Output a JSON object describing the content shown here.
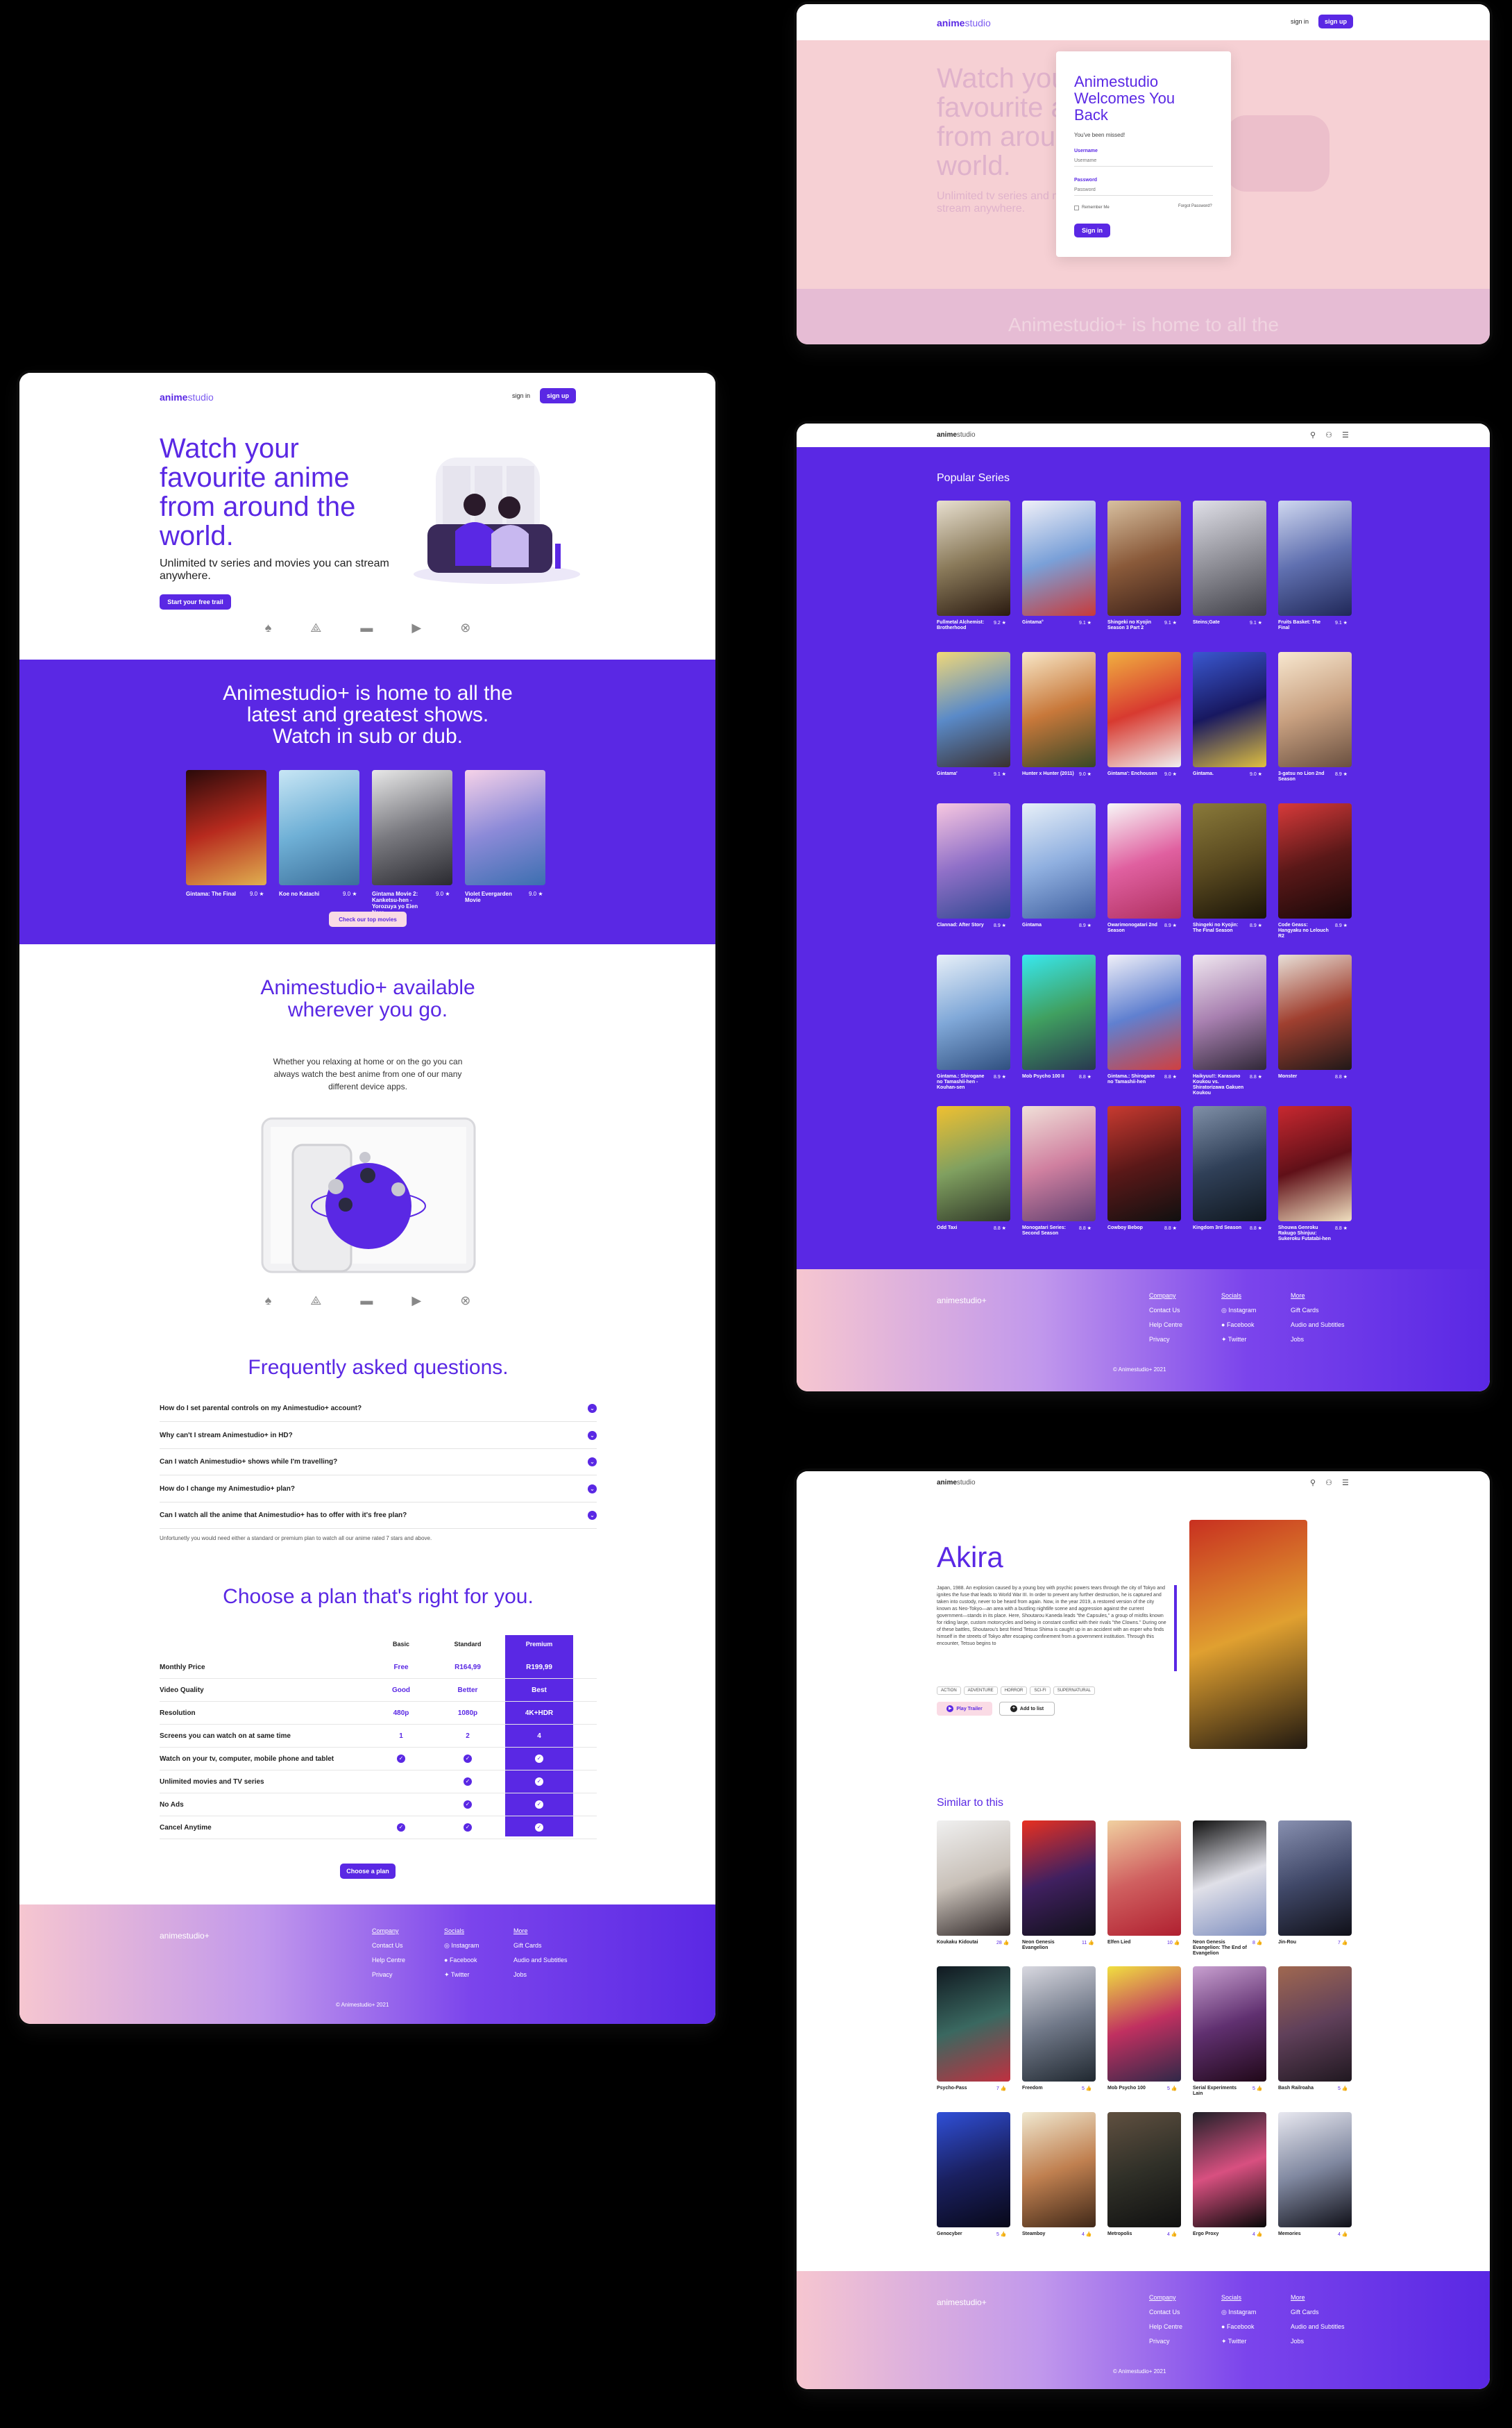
{
  "brand": {
    "logo_a": "anime",
    "logo_b": "studio",
    "logo_plus": "animestudio+"
  },
  "nav": {
    "signin": "sign in",
    "signup": "sign up"
  },
  "hero": {
    "title": "Watch your favourite anime from around the world.",
    "subtitle": "Unlimited tv series and movies you can stream anywhere.",
    "cta": "Start your free trail"
  },
  "devices": [
    "playstation-icon",
    "apple-tv-icon",
    "tv-icon",
    "google-play-icon",
    "xbox-icon"
  ],
  "latest": {
    "title": "Animestudio+ is home to all the latest and greatest shows. Watch in sub or dub.",
    "cta": "Check our top movies",
    "movies": [
      {
        "title": "Gintama: The Final",
        "rating": "9.0 ★",
        "colors": [
          "#2a0a0a",
          "#b72a1e",
          "#e0b050"
        ]
      },
      {
        "title": "Koe no Katachi",
        "rating": "9.0 ★",
        "colors": [
          "#c8e6f5",
          "#6fb0d6",
          "#3c6f9a"
        ]
      },
      {
        "title": "Gintama Movie 2: Kanketsu-hen - Yorozuya yo Eien Nare",
        "rating": "9.0 ★",
        "colors": [
          "#e8e8e8",
          "#7a7a80",
          "#2a2a30"
        ]
      },
      {
        "title": "Violet Evergarden Movie",
        "rating": "9.0 ★",
        "colors": [
          "#f6d2e8",
          "#8c8ad8",
          "#3c6fb0"
        ]
      }
    ]
  },
  "available": {
    "title": "Animestudio+ available wherever you go.",
    "text": "Whether you relaxing at home or on the go you can always watch the best anime from one of our many different device apps."
  },
  "faq": {
    "title": "Frequently asked questions.",
    "items": [
      "How do I set parental controls on my Animestudio+ account?",
      "Why can't I stream Animestudio+ in HD?",
      "Can I watch Animestudio+ shows while I'm travelling?",
      "How do I change my Animestudio+ plan?",
      "Can I watch all the anime that Animestudio+ has to offer with it's free plan?"
    ],
    "answer": "Unfortunetly you would need either a standard or premium plan to watch all our anime rated 7 stars and above."
  },
  "plans": {
    "title": "Choose a plan that's right for you.",
    "cols": [
      "Basic",
      "Standard",
      "Premium"
    ],
    "cta": "Choose a plan",
    "rows": [
      {
        "label": "Monthly Price",
        "vals": [
          "Free",
          "R164,99",
          "R199,99"
        ]
      },
      {
        "label": "Video Quality",
        "vals": [
          "Good",
          "Better",
          "Best"
        ]
      },
      {
        "label": "Resolution",
        "vals": [
          "480p",
          "1080p",
          "4K+HDR"
        ]
      },
      {
        "label": "Screens you can watch on at same time",
        "vals": [
          "1",
          "2",
          "4"
        ]
      },
      {
        "label": "Watch on your tv, computer, mobile phone and tablet",
        "vals": [
          "✓",
          "✓",
          "✓"
        ]
      },
      {
        "label": "Unlimited movies and TV series",
        "vals": [
          "",
          "✓",
          "✓"
        ]
      },
      {
        "label": "No Ads",
        "vals": [
          "",
          "✓",
          "✓"
        ]
      },
      {
        "label": "Cancel Anytime",
        "vals": [
          "✓",
          "✓",
          "✓"
        ]
      }
    ]
  },
  "footer": {
    "company": "Company",
    "company_links": [
      "Contact Us",
      "Help Centre",
      "Privacy"
    ],
    "socials": "Socials",
    "social_links": [
      "Instagram",
      "Facebook",
      "Twitter"
    ],
    "more": "More",
    "more_links": [
      "Gift Cards",
      "Audio and Subtitles",
      "Jobs"
    ],
    "copyright": "© Animestudio+ 2021"
  },
  "login": {
    "title": "Animestudio Welcomes You Back",
    "subtitle": "You've been missed!",
    "username_label": "Username",
    "username_ph": "Username",
    "password_label": "Password",
    "password_ph": "Password",
    "remember": "Remember Me",
    "forgot": "Forgot Password?",
    "signin": "Sign in",
    "bg_title": "Watch your favourite anime from around the world.",
    "bg_sub": "Unlimited tv series and movies you can stream anywhere.",
    "bg_band": "Animestudio+ is home to all the"
  },
  "popular": {
    "title": "Popular Series",
    "items": [
      {
        "t": "Fullmetal Alchemist: Brotherhood",
        "r": "9.2 ★",
        "c": [
          "#e8e0d0",
          "#8a7a5a",
          "#2a1a10"
        ]
      },
      {
        "t": "Gintama°",
        "r": "9.1 ★",
        "c": [
          "#f0f0f8",
          "#7aa0d8",
          "#c83a3a"
        ]
      },
      {
        "t": "Shingeki no Kyojin Season 3 Part 2",
        "r": "9.1 ★",
        "c": [
          "#d8c0a0",
          "#8a5a3a",
          "#3a2018"
        ]
      },
      {
        "t": "Steins;Gate",
        "r": "9.1 ★",
        "c": [
          "#e0e0e8",
          "#909098",
          "#404048"
        ]
      },
      {
        "t": "Fruits Basket: The Final",
        "r": "9.1 ★",
        "c": [
          "#d0d8f0",
          "#6070b0",
          "#202858"
        ]
      },
      {
        "t": "Gintama'",
        "r": "9.1 ★",
        "c": [
          "#f0d878",
          "#5a8ac8",
          "#3a3030"
        ]
      },
      {
        "t": "Hunter x Hunter (2011)",
        "r": "9.0 ★",
        "c": [
          "#f8e8c8",
          "#c8783a",
          "#384828"
        ]
      },
      {
        "t": "Gintama': Enchousen",
        "r": "9.0 ★",
        "c": [
          "#f0b040",
          "#d83a30",
          "#f0f0f0"
        ]
      },
      {
        "t": "Gintama.",
        "r": "9.0 ★",
        "c": [
          "#3a58d0",
          "#181860",
          "#e0c040"
        ]
      },
      {
        "t": "3-gatsu no Lion 2nd Season",
        "r": "8.9 ★",
        "c": [
          "#f8e8d0",
          "#c8a080",
          "#6a5040"
        ]
      },
      {
        "t": "Clannad: After Story",
        "r": "8.9 ★",
        "c": [
          "#f8c8e0",
          "#9070c8",
          "#304890"
        ]
      },
      {
        "t": "Gintama",
        "r": "8.9 ★",
        "c": [
          "#e8f0f8",
          "#90b0e0",
          "#4060a0"
        ]
      },
      {
        "t": "Owarimonogatari 2nd Season",
        "r": "8.9 ★",
        "c": [
          "#f8f8f8",
          "#e060a0",
          "#b03060"
        ]
      },
      {
        "t": "Shingeki no Kyojin: The Final Season",
        "r": "8.9 ★",
        "c": [
          "#8a7a3a",
          "#5a4a20",
          "#1a1408"
        ]
      },
      {
        "t": "Code Geass: Hangyaku no Lelouch R2",
        "r": "8.9 ★",
        "c": [
          "#d83a3a",
          "#5a1818",
          "#180808"
        ]
      },
      {
        "t": "Gintama.: Shirogane no Tamashii-hen - Kouhan-sen",
        "r": "8.9 ★",
        "c": [
          "#e8f0f8",
          "#80a8d8",
          "#305080"
        ]
      },
      {
        "t": "Mob Psycho 100 II",
        "r": "8.8 ★",
        "c": [
          "#38e8f0",
          "#40a060",
          "#283850"
        ]
      },
      {
        "t": "Gintama.: Shirogane no Tamashii-hen",
        "r": "8.8 ★",
        "c": [
          "#f0f0f8",
          "#6080d0",
          "#d04040"
        ]
      },
      {
        "t": "Haikyuu!!: Karasuno Koukou vs. Shiratorizawa Gakuen Koukou",
        "r": "8.8 ★",
        "c": [
          "#f0e8f0",
          "#a880b0",
          "#302838"
        ]
      },
      {
        "t": "Monster",
        "r": "8.8 ★",
        "c": [
          "#e8e0d8",
          "#a04030",
          "#201818"
        ]
      },
      {
        "t": "Odd Taxi",
        "r": "8.8 ★",
        "c": [
          "#f0c030",
          "#80a060",
          "#303828"
        ]
      },
      {
        "t": "Monogatari Series: Second Season",
        "r": "8.8 ★",
        "c": [
          "#f0e0d8",
          "#d080a0",
          "#604070"
        ]
      },
      {
        "t": "Cowboy Bebop",
        "r": "8.8 ★",
        "c": [
          "#c83a30",
          "#5a1818",
          "#101010"
        ]
      },
      {
        "t": "Kingdom 3rd Season",
        "r": "8.8 ★",
        "c": [
          "#8090a8",
          "#304058",
          "#101820"
        ]
      },
      {
        "t": "Shouwa Genroku Rakugo Shinjuu: Sukeroku Futatabi-hen",
        "r": "8.8 ★",
        "c": [
          "#c82830",
          "#601018",
          "#f0e0c0"
        ]
      }
    ]
  },
  "detail": {
    "title": "Akira",
    "desc": "Japan, 1988. An explosion caused by a young boy with psychic powers tears through the city of Tokyo and ignites the fuse that leads to World War III. In order to prevent any further destruction, he is captured and taken into custody, never to be heard from again. Now, in the year 2019, a restored version of the city known as Neo-Tokyo—an area with a bustling nightlife scene and aggression against the current government—stands in its place. Here, Shoutarou Kaneda leads \"the Capsules,\" a group of misfits known for riding large, custom motorcycles and being in constant conflict with their rivals \"the Clowns.\" During one of these battles, Shoutarou's best friend Tetsuo Shima is caught up in an accident with an esper who finds himself in the streets of Tokyo after escaping confinement from a government institution. Through this encounter, Tetsuo begins to",
    "tags": [
      "ACTION",
      "ADVENTURE",
      "HORROR",
      "SCI-FI",
      "SUPERNATURAL"
    ],
    "trailer": "Play Trailer",
    "addlist": "Add to list",
    "poster": [
      "#c83020",
      "#e0a030",
      "#201810"
    ],
    "similar_title": "Similar to this",
    "similar": [
      {
        "t": "Koukaku Kidoutai",
        "r": "28 👍",
        "c": [
          "#f0f0f0",
          "#c8c0b8",
          "#302828"
        ]
      },
      {
        "t": "Neon Genesis Evangelion",
        "r": "11 👍",
        "c": [
          "#e83020",
          "#402060",
          "#101018"
        ]
      },
      {
        "t": "Elfen Lied",
        "r": "10 👍",
        "c": [
          "#f0d0a0",
          "#d06060",
          "#b02030"
        ]
      },
      {
        "t": "Neon Genesis Evangelion: The End of Evangelion",
        "r": "8 👍",
        "c": [
          "#101010",
          "#e0e0e8",
          "#8090c0"
        ]
      },
      {
        "t": "Jin-Rou",
        "r": "7 👍",
        "c": [
          "#8890b0",
          "#404868",
          "#101018"
        ]
      },
      {
        "t": "Psycho-Pass",
        "r": "7 👍",
        "c": [
          "#101820",
          "#3a6860",
          "#c03040"
        ]
      },
      {
        "t": "Freedom",
        "r": "5 👍",
        "c": [
          "#d8d8e0",
          "#707888",
          "#202830"
        ]
      },
      {
        "t": "Mob Psycho 100",
        "r": "5 👍",
        "c": [
          "#f0e040",
          "#c03060",
          "#302848"
        ]
      },
      {
        "t": "Serial Experiments Lain",
        "r": "5 👍",
        "c": [
          "#c8a0d0",
          "#603070",
          "#200818"
        ]
      },
      {
        "t": "Bash Railroaha",
        "r": "5 👍",
        "c": [
          "#a06850",
          "#60405a",
          "#201820"
        ]
      },
      {
        "t": "Genocyber",
        "r": "5 👍",
        "c": [
          "#3050d8",
          "#1a2060",
          "#080818"
        ]
      },
      {
        "t": "Steamboy",
        "r": "4 👍",
        "c": [
          "#f0e8d0",
          "#c08050",
          "#402818"
        ]
      },
      {
        "t": "Metropolis",
        "r": "4 👍",
        "c": [
          "#605040",
          "#303028",
          "#101010"
        ]
      },
      {
        "t": "Ergo Proxy",
        "r": "4 👍",
        "c": [
          "#202028",
          "#d85080",
          "#080808"
        ]
      },
      {
        "t": "Memories",
        "r": "4 👍",
        "c": [
          "#e8e8f0",
          "#8088a0",
          "#101018"
        ]
      }
    ]
  },
  "colors": {
    "accent": "#5a28e4",
    "bg": "#000000"
  }
}
